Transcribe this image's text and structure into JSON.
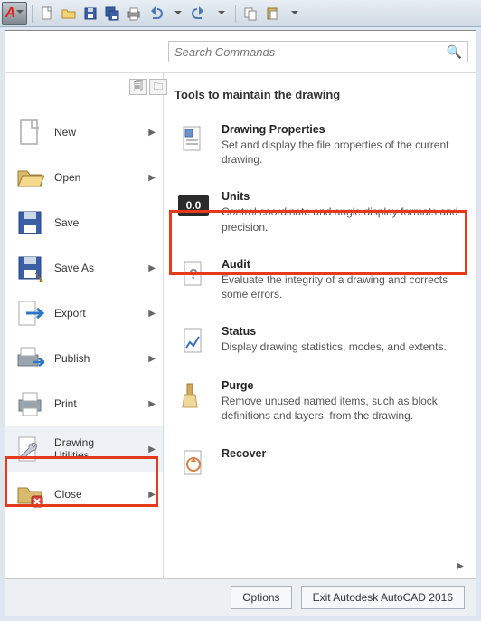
{
  "qat": {
    "items": [
      "new",
      "open",
      "save",
      "saveall",
      "print",
      "undo",
      "redo",
      "copy",
      "paste"
    ]
  },
  "search": {
    "placeholder": "Search Commands"
  },
  "menu": [
    {
      "label": "New",
      "arrow": true
    },
    {
      "label": "Open",
      "arrow": true
    },
    {
      "label": "Save",
      "arrow": false
    },
    {
      "label": "Save As",
      "arrow": true
    },
    {
      "label": "Export",
      "arrow": true
    },
    {
      "label": "Publish",
      "arrow": true
    },
    {
      "label": "Print",
      "arrow": true
    },
    {
      "label": "Drawing\nUtilities",
      "arrow": true,
      "selected": true
    },
    {
      "label": "Close",
      "arrow": true
    }
  ],
  "panel": {
    "title": "Tools to maintain the drawing",
    "items": [
      {
        "title": "Drawing Properties",
        "desc": "Set and display the file properties of the current drawing."
      },
      {
        "title": "Units",
        "desc": "Control coordinate and angle display formats and precision.",
        "highlight": true,
        "badge": "0.0"
      },
      {
        "title": "Audit",
        "desc": "Evaluate the integrity of a drawing and corrects some errors."
      },
      {
        "title": "Status",
        "desc": "Display drawing statistics, modes, and extents."
      },
      {
        "title": "Purge",
        "desc": "Remove unused named items, such as block definitions and layers, from the drawing."
      },
      {
        "title": "Recover",
        "desc": ""
      }
    ]
  },
  "footer": {
    "options": "Options",
    "exit": "Exit Autodesk AutoCAD 2016"
  }
}
